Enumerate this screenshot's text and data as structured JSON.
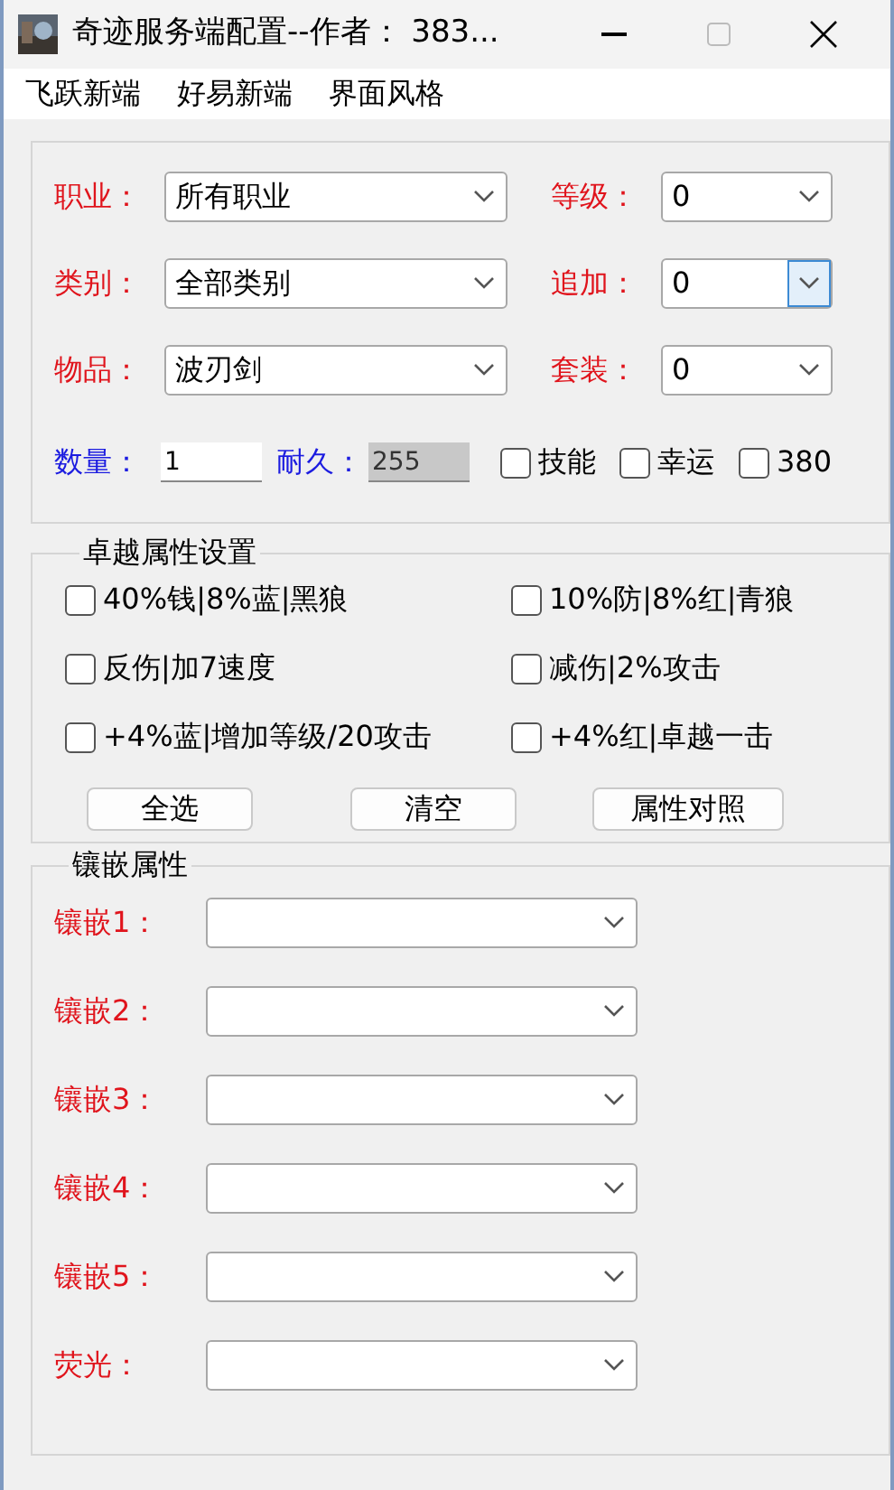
{
  "window": {
    "title": "奇迹服务端配置--作者： 383..."
  },
  "menu": [
    {
      "label": "飞跃新端"
    },
    {
      "label": "好易新端"
    },
    {
      "label": "界面风格"
    }
  ],
  "item_group": {
    "selects": [
      {
        "label": "职业：",
        "value": "所有职业",
        "focused": false
      },
      {
        "label": "等级：",
        "value": "0",
        "focused": false
      },
      {
        "label": "类别：",
        "value": "全部类别",
        "focused": false
      },
      {
        "label": "追加：",
        "value": "0",
        "focused": true
      },
      {
        "label": "物品：",
        "value": "波刃剑",
        "focused": false
      },
      {
        "label": "套装：",
        "value": "0",
        "focused": false
      }
    ],
    "inputs": [
      {
        "label": "数量：",
        "value": "1",
        "disabled": false
      },
      {
        "label": "耐久：",
        "value": "255",
        "disabled": true
      }
    ],
    "checkboxes": [
      {
        "label": "技能",
        "checked": false
      },
      {
        "label": "幸运",
        "checked": false
      },
      {
        "label": "380",
        "checked": false
      }
    ]
  },
  "excellent_group": {
    "title": "卓越属性设置",
    "options": [
      {
        "label": "40%钱|8%蓝|黑狼",
        "checked": false
      },
      {
        "label": "10%防|8%红|青狼",
        "checked": false
      },
      {
        "label": "反伤|加7速度",
        "checked": false
      },
      {
        "label": "减伤|2%攻击",
        "checked": false
      },
      {
        "label": "+4%蓝|增加等级/20攻击",
        "checked": false
      },
      {
        "label": "+4%红|卓越一击",
        "checked": false
      }
    ],
    "buttons": [
      "全选",
      "清空",
      "属性对照"
    ]
  },
  "socket_group": {
    "title": "镶嵌属性",
    "selects": [
      {
        "label": "镶嵌1："
      },
      {
        "label": "镶嵌2："
      },
      {
        "label": "镶嵌3："
      },
      {
        "label": "镶嵌4："
      },
      {
        "label": "镶嵌5："
      },
      {
        "label": "荧光："
      }
    ]
  }
}
